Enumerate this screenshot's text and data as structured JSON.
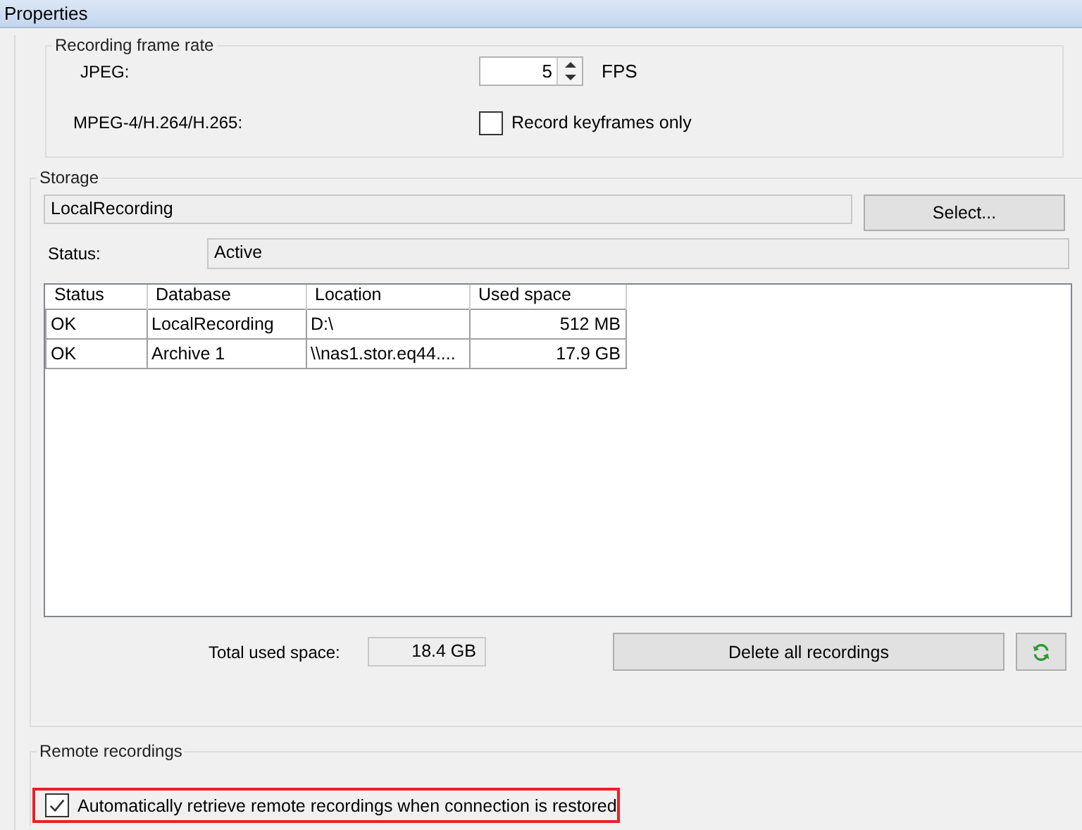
{
  "window": {
    "title": "Properties"
  },
  "frame_rate": {
    "title": "Recording frame rate",
    "jpeg_label": "JPEG:",
    "jpeg_value": "5",
    "jpeg_unit": "FPS",
    "mpeg_label": "MPEG-4/H.264/H.265:",
    "keyframes": {
      "label": "Record keyframes only",
      "checked": false
    }
  },
  "storage": {
    "title": "Storage",
    "name": "LocalRecording",
    "select_button": "Select...",
    "status_label": "Status:",
    "status_value": "Active",
    "table": {
      "columns": [
        "Status",
        "Database",
        "Location",
        "Used space"
      ],
      "rows": [
        [
          "OK",
          "LocalRecording",
          "D:\\",
          "512 MB"
        ],
        [
          "OK",
          "Archive 1",
          "\\\\nas1.stor.eq44....",
          "17.9 GB"
        ]
      ]
    },
    "total_label": "Total used space:",
    "total_value": "18.4 GB",
    "delete_button": "Delete all recordings"
  },
  "remote": {
    "title": "Remote recordings",
    "auto_retrieve": {
      "label": "Automatically retrieve remote recordings when connection is restored",
      "checked": true,
      "highlighted": true
    }
  }
}
